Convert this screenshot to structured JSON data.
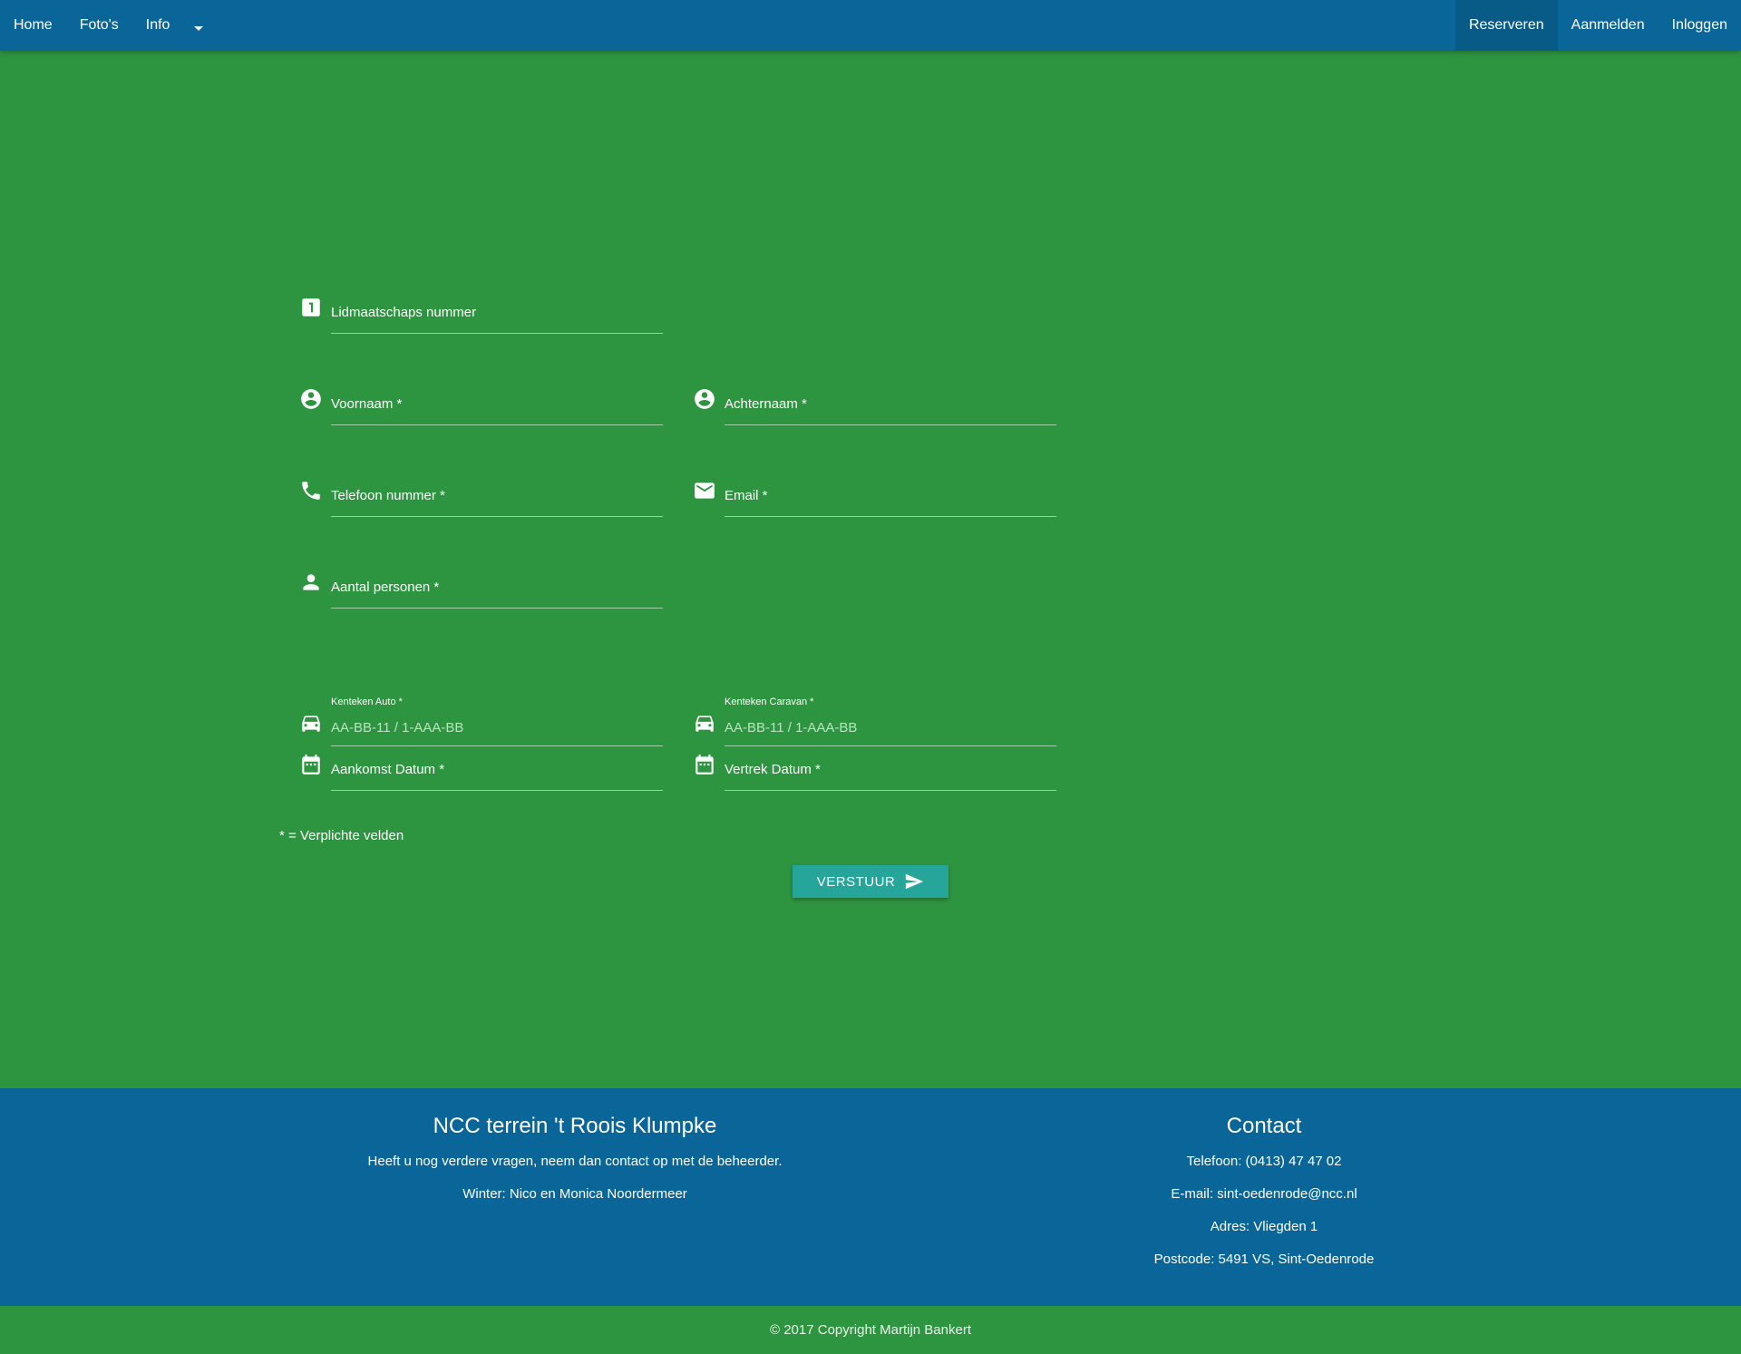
{
  "nav": {
    "left": [
      {
        "label": "Home"
      },
      {
        "label": "Foto's"
      },
      {
        "label": "Info"
      }
    ],
    "right": [
      {
        "label": "Reserveren",
        "active": true
      },
      {
        "label": "Aanmelden"
      },
      {
        "label": "Inloggen"
      }
    ],
    "dropdown_icon": "caret-down-icon"
  },
  "form": {
    "membership": {
      "label": "Lidmaatschaps nummer",
      "icon": "looks-one-icon"
    },
    "firstname": {
      "label": "Voornaam *",
      "icon": "account-circle-icon"
    },
    "lastname": {
      "label": "Achternaam *",
      "icon": "account-circle-icon"
    },
    "phone": {
      "label": "Telefoon nummer *",
      "icon": "phone-icon"
    },
    "email": {
      "label": "Email *",
      "icon": "mail-icon"
    },
    "persons": {
      "label": "Aantal personen *",
      "icon": "person-icon"
    },
    "car_plate": {
      "label": "Kenteken Auto *",
      "placeholder": "AA-BB-11 / 1-AAA-BB",
      "icon": "car-icon"
    },
    "caravan_plate": {
      "label": "Kenteken Caravan *",
      "placeholder": "AA-BB-11 / 1-AAA-BB",
      "icon": "car-icon"
    },
    "arrival": {
      "label": "Aankomst Datum *",
      "icon": "calendar-icon"
    },
    "departure": {
      "label": "Vertrek Datum *",
      "icon": "calendar-icon"
    },
    "required_note": "* = Verplichte velden",
    "submit_label": "VERSTUUR",
    "submit_icon": "send-icon"
  },
  "footer": {
    "left": {
      "title": "NCC terrein 't Roois Klumpke",
      "lines": [
        "Heeft u nog verdere vragen, neem dan contact op met de beheerder.",
        "Winter: Nico en Monica Noordermeer"
      ]
    },
    "right": {
      "title": "Contact",
      "lines": [
        "Telefoon: (0413) 47 47 02",
        "E-mail: sint-oedenrode@ncc.nl",
        "Adres: Vliegden 1",
        "Postcode: 5491 VS, Sint-Oedenrode"
      ]
    },
    "copyright": "© 2017 Copyright Martijn Bankert"
  },
  "colors": {
    "navbar": "#0a6699",
    "background": "#2d9540",
    "button": "#26a69a"
  }
}
